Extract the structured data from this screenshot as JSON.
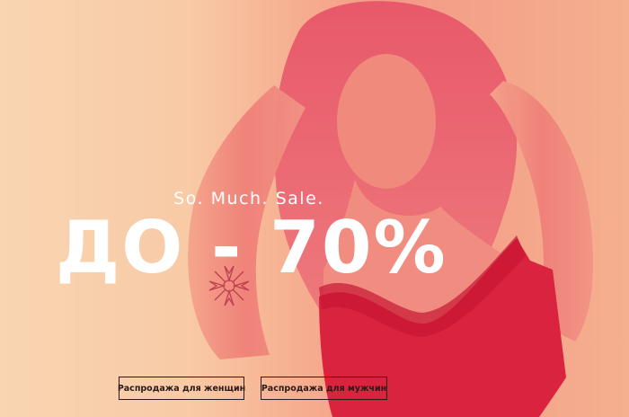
{
  "banner": {
    "subtitle": "So. Much. Sale.",
    "headline": "ДО - 70%",
    "colors": {
      "background_light": "#f9d5b2",
      "figure_red": "#e8485a",
      "bra_red": "#d7193a",
      "text": "#ffffff",
      "button_border": "#2a1a18"
    },
    "buttons": [
      {
        "label": "Распродажа для женщин"
      },
      {
        "label": "Распродажа для мужчин"
      }
    ]
  }
}
